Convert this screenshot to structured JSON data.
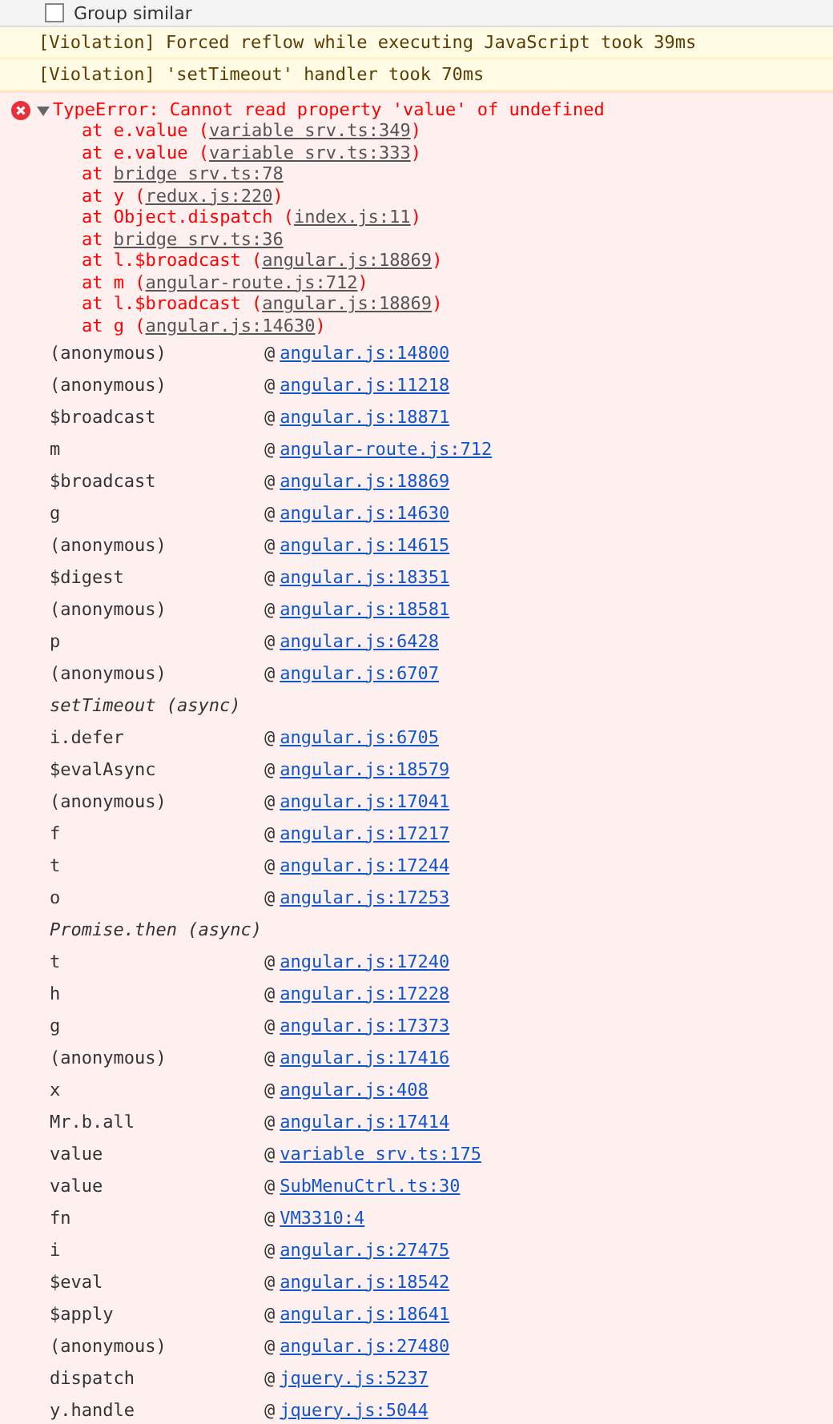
{
  "toolbar": {
    "group_similar": {
      "label": "Group similar",
      "checked": false
    }
  },
  "violations": [
    "[Violation] Forced reflow while executing JavaScript took 39ms",
    "[Violation] 'setTimeout' handler took 70ms"
  ],
  "error": {
    "expanded": true,
    "message": "TypeError: Cannot read property 'value' of undefined",
    "stack": [
      {
        "before": "at e.value (",
        "link": "variable srv.ts:349",
        "after": ")"
      },
      {
        "before": "at e.value (",
        "link": "variable srv.ts:333",
        "after": ")"
      },
      {
        "before": "at ",
        "link": "bridge srv.ts:78"
      },
      {
        "before": "at y (",
        "link": "redux.js:220",
        "after": ")"
      },
      {
        "before": "at Object.dispatch (",
        "link": "index.js:11",
        "after": ")"
      },
      {
        "before": "at ",
        "link": "bridge srv.ts:36"
      },
      {
        "before": "at l.$broadcast (",
        "link": "angular.js:18869",
        "after": ")"
      },
      {
        "before": "at m (",
        "link": "angular-route.js:712",
        "after": ")"
      },
      {
        "before": "at l.$broadcast (",
        "link": "angular.js:18869",
        "after": ")"
      },
      {
        "before": "at g (",
        "link": "angular.js:14630",
        "after": ")"
      }
    ],
    "frames": [
      {
        "kind": "frame",
        "func": "(anonymous)",
        "sep": "@",
        "link": "angular.js:14800"
      },
      {
        "kind": "frame",
        "func": "(anonymous)",
        "sep": "@",
        "link": "angular.js:11218"
      },
      {
        "kind": "frame",
        "func": "$broadcast",
        "sep": "@",
        "link": "angular.js:18871"
      },
      {
        "kind": "frame",
        "func": "m",
        "sep": "@",
        "link": "angular-route.js:712"
      },
      {
        "kind": "frame",
        "func": "$broadcast",
        "sep": "@",
        "link": "angular.js:18869"
      },
      {
        "kind": "frame",
        "func": "g",
        "sep": "@",
        "link": "angular.js:14630"
      },
      {
        "kind": "frame",
        "func": "(anonymous)",
        "sep": "@",
        "link": "angular.js:14615"
      },
      {
        "kind": "frame",
        "func": "$digest",
        "sep": "@",
        "link": "angular.js:18351"
      },
      {
        "kind": "frame",
        "func": "(anonymous)",
        "sep": "@",
        "link": "angular.js:18581"
      },
      {
        "kind": "frame",
        "func": "p",
        "sep": "@",
        "link": "angular.js:6428"
      },
      {
        "kind": "frame",
        "func": "(anonymous)",
        "sep": "@",
        "link": "angular.js:6707"
      },
      {
        "kind": "async",
        "label": "setTimeout (async)"
      },
      {
        "kind": "frame",
        "func": "i.defer",
        "sep": "@",
        "link": "angular.js:6705"
      },
      {
        "kind": "frame",
        "func": "$evalAsync",
        "sep": "@",
        "link": "angular.js:18579"
      },
      {
        "kind": "frame",
        "func": "(anonymous)",
        "sep": "@",
        "link": "angular.js:17041"
      },
      {
        "kind": "frame",
        "func": "f",
        "sep": "@",
        "link": "angular.js:17217"
      },
      {
        "kind": "frame",
        "func": "t",
        "sep": "@",
        "link": "angular.js:17244"
      },
      {
        "kind": "frame",
        "func": "o",
        "sep": "@",
        "link": "angular.js:17253"
      },
      {
        "kind": "async",
        "label": "Promise.then (async)"
      },
      {
        "kind": "frame",
        "func": "t",
        "sep": "@",
        "link": "angular.js:17240"
      },
      {
        "kind": "frame",
        "func": "h",
        "sep": "@",
        "link": "angular.js:17228"
      },
      {
        "kind": "frame",
        "func": "g",
        "sep": "@",
        "link": "angular.js:17373"
      },
      {
        "kind": "frame",
        "func": "(anonymous)",
        "sep": "@",
        "link": "angular.js:17416"
      },
      {
        "kind": "frame",
        "func": "x",
        "sep": "@",
        "link": "angular.js:408"
      },
      {
        "kind": "frame",
        "func": "Mr.b.all",
        "sep": "@",
        "link": "angular.js:17414"
      },
      {
        "kind": "frame",
        "func": "value",
        "sep": "@",
        "link": "variable srv.ts:175"
      },
      {
        "kind": "frame",
        "func": "value",
        "sep": "@",
        "link": "SubMenuCtrl.ts:30"
      },
      {
        "kind": "frame",
        "func": "fn",
        "sep": "@",
        "link": "VM3310:4"
      },
      {
        "kind": "frame",
        "func": "i",
        "sep": "@",
        "link": "angular.js:27475"
      },
      {
        "kind": "frame",
        "func": "$eval",
        "sep": "@",
        "link": "angular.js:18542"
      },
      {
        "kind": "frame",
        "func": "$apply",
        "sep": "@",
        "link": "angular.js:18641"
      },
      {
        "kind": "frame",
        "func": "(anonymous)",
        "sep": "@",
        "link": "angular.js:27480"
      },
      {
        "kind": "frame",
        "func": "dispatch",
        "sep": "@",
        "link": "jquery.js:5237"
      },
      {
        "kind": "frame",
        "func": "y.handle",
        "sep": "@",
        "link": "jquery.js:5044"
      }
    ]
  }
}
